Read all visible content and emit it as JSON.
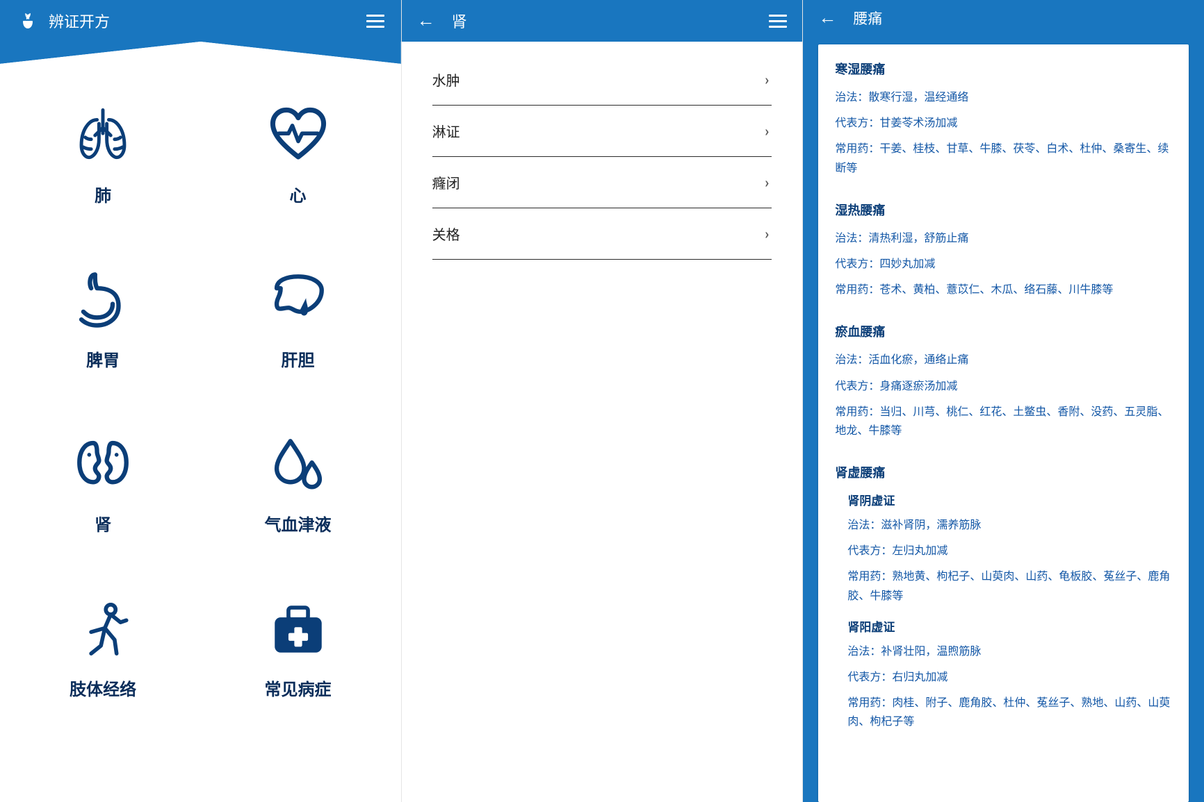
{
  "panel1": {
    "title": "辨证开方",
    "tiles": [
      {
        "label": "肺"
      },
      {
        "label": "心"
      },
      {
        "label": "脾胃"
      },
      {
        "label": "肝胆"
      },
      {
        "label": "肾"
      },
      {
        "label": "气血津液"
      },
      {
        "label": "肢体经络"
      },
      {
        "label": "常见病症"
      }
    ]
  },
  "panel2": {
    "title": "肾",
    "items": [
      {
        "label": "水肿"
      },
      {
        "label": "淋证"
      },
      {
        "label": "癃闭"
      },
      {
        "label": "关格"
      }
    ]
  },
  "panel3": {
    "title": "腰痛",
    "sections": [
      {
        "title": "寒湿腰痛",
        "zhifa": "治法：散寒行湿，温经通络",
        "daibiaofang": "代表方：甘姜苓术汤加减",
        "changyongyao": "常用药：干姜、桂枝、甘草、牛膝、茯苓、白术、杜仲、桑寄生、续断等"
      },
      {
        "title": "湿热腰痛",
        "zhifa": "治法：清热利湿，舒筋止痛",
        "daibiaofang": "代表方：四妙丸加减",
        "changyongyao": "常用药：苍术、黄柏、薏苡仁、木瓜、络石藤、川牛膝等"
      },
      {
        "title": "瘀血腰痛",
        "zhifa": "治法：活血化瘀，通络止痛",
        "daibiaofang": "代表方：身痛逐瘀汤加减",
        "changyongyao": "常用药：当归、川芎、桃仁、红花、土鳖虫、香附、没药、五灵脂、地龙、牛膝等"
      },
      {
        "title": "肾虚腰痛",
        "subs": [
          {
            "title": "肾阴虚证",
            "zhifa": "治法：滋补肾阴，濡养筋脉",
            "daibiaofang": "代表方：左归丸加减",
            "changyongyao": "常用药：熟地黄、枸杞子、山萸肉、山药、龟板胶、菟丝子、鹿角胶、牛膝等"
          },
          {
            "title": "肾阳虚证",
            "zhifa": "治法：补肾壮阳，温煦筋脉",
            "daibiaofang": "代表方：右归丸加减",
            "changyongyao": "常用药：肉桂、附子、鹿角胶、杜仲、菟丝子、熟地、山药、山萸肉、枸杞子等"
          }
        ]
      }
    ]
  }
}
